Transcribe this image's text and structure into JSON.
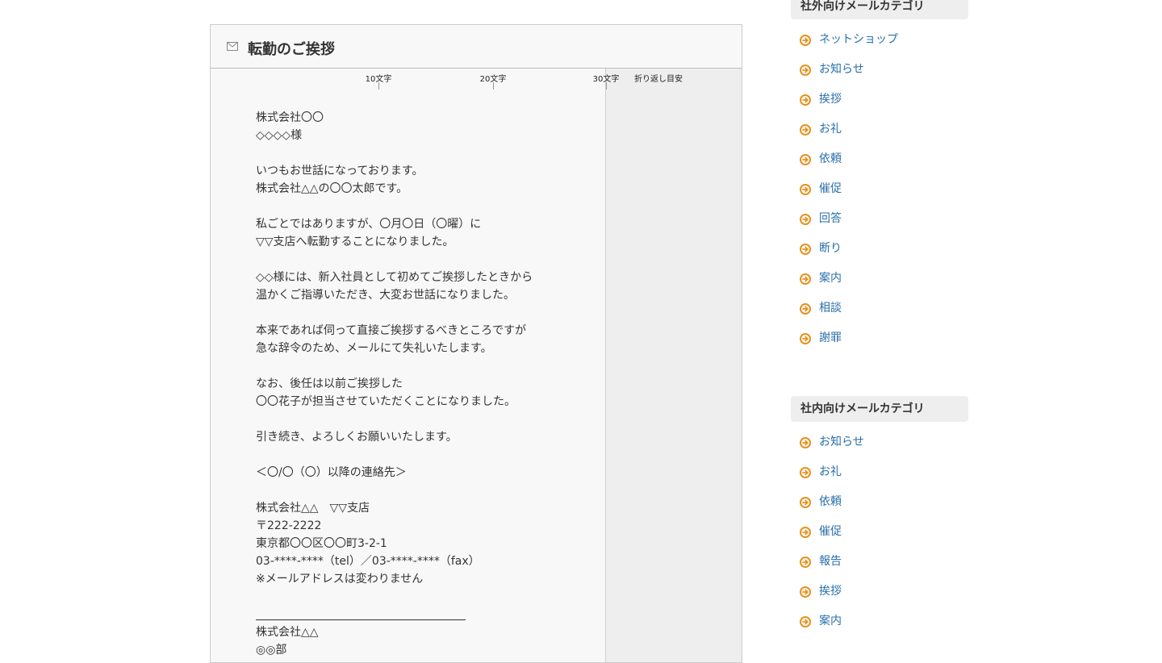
{
  "article": {
    "title": "転勤のご挨拶",
    "ruler": {
      "label_10": "10文字",
      "label_20": "20文字",
      "label_30": "30文字",
      "label_wrap": "折り返し目安"
    },
    "body_lines": [
      "株式会社〇〇",
      "◇◇◇◇様",
      "",
      "いつもお世話になっております。",
      "株式会社△△の〇〇太郎です。",
      "",
      "私ごとではありますが、〇月〇日（〇曜）に",
      "▽▽支店へ転勤することになりました。",
      "",
      "◇◇様には、新入社員として初めてご挨拶したときから",
      "温かくご指導いただき、大変お世話になりました。",
      "",
      "本来であれば伺って直接ご挨拶するべきところですが",
      "急な辞令のため、メールにて失礼いたします。",
      "",
      "なお、後任は以前ご挨拶した",
      "〇〇花子が担当させていただくことになりました。",
      "",
      "引き続き、よろしくお願いいたします。",
      "",
      "＜〇/〇（〇）以降の連絡先＞",
      "",
      "株式会社△△　▽▽支店",
      "〒222-2222",
      "東京都〇〇区〇〇町3-2-1",
      "03-****-****（tel）／03-****-****（fax）",
      "※メールアドレスは変わりません",
      "",
      "",
      "株式会社△△",
      "◎◎部"
    ]
  },
  "sidebar": {
    "external": {
      "header": "社外向けメールカテゴリ",
      "items": [
        "ネットショップ",
        "お知らせ",
        "挨拶",
        "お礼",
        "依頼",
        "催促",
        "回答",
        "断り",
        "案内",
        "相談",
        "謝罪"
      ]
    },
    "internal": {
      "header": "社内向けメールカテゴリ",
      "items": [
        "お知らせ",
        "お礼",
        "依頼",
        "催促",
        "報告",
        "挨拶",
        "案内"
      ]
    }
  },
  "colors": {
    "accent_orange": "#e8901c",
    "link_blue": "#2a6faa"
  }
}
